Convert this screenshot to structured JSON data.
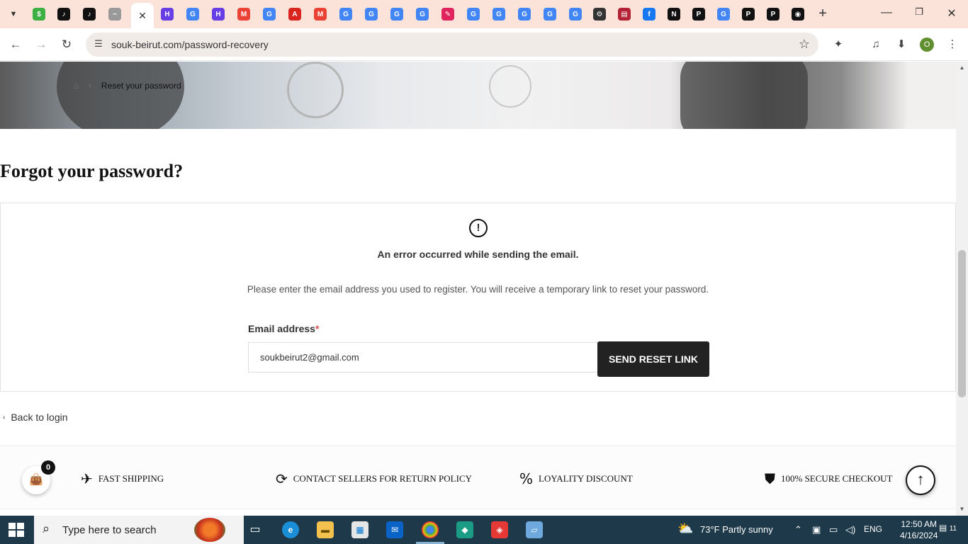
{
  "browser": {
    "tab_favicons": [
      {
        "icon": "dollar-icon",
        "glyph": "$",
        "color": "#3cb043"
      },
      {
        "icon": "tiktok-icon",
        "glyph": "♪",
        "color": "#111111"
      },
      {
        "icon": "tiktok-icon",
        "glyph": "♪",
        "color": "#111111"
      },
      {
        "icon": "souk-logo-icon",
        "glyph": "~",
        "color": "#999999"
      },
      {
        "icon": "hostinger-icon",
        "glyph": "H",
        "color": "#673de6"
      },
      {
        "icon": "google-icon",
        "glyph": "G",
        "color": "#4285f4"
      },
      {
        "icon": "hostinger-icon",
        "glyph": "H",
        "color": "#673de6"
      },
      {
        "icon": "gmail-icon",
        "glyph": "M",
        "color": "#ea4335"
      },
      {
        "icon": "google-icon",
        "glyph": "G",
        "color": "#4285f4"
      },
      {
        "icon": "adobe-icon",
        "glyph": "A",
        "color": "#d9251d"
      },
      {
        "icon": "gmail-icon",
        "glyph": "M",
        "color": "#ea4335"
      },
      {
        "icon": "google-icon",
        "glyph": "G",
        "color": "#4285f4"
      },
      {
        "icon": "google-icon",
        "glyph": "G",
        "color": "#4285f4"
      },
      {
        "icon": "google-icon",
        "glyph": "G",
        "color": "#4285f4"
      },
      {
        "icon": "google-icon",
        "glyph": "G",
        "color": "#4285f4"
      },
      {
        "icon": "feather-icon",
        "glyph": "✎",
        "color": "#e0245e"
      },
      {
        "icon": "google-icon",
        "glyph": "G",
        "color": "#4285f4"
      },
      {
        "icon": "google-icon",
        "glyph": "G",
        "color": "#4285f4"
      },
      {
        "icon": "google-icon",
        "glyph": "G",
        "color": "#4285f4"
      },
      {
        "icon": "google-icon",
        "glyph": "G",
        "color": "#4285f4"
      },
      {
        "icon": "google-icon",
        "glyph": "G",
        "color": "#4285f4"
      },
      {
        "icon": "settings-icon",
        "glyph": "⚙",
        "color": "#333333"
      },
      {
        "icon": "flag-icon",
        "glyph": "▤",
        "color": "#b22234"
      },
      {
        "icon": "facebook-icon",
        "glyph": "f",
        "color": "#1877f2"
      },
      {
        "icon": "notion-icon",
        "glyph": "N",
        "color": "#111111"
      },
      {
        "icon": "picsart-icon",
        "glyph": "P",
        "color": "#111111"
      },
      {
        "icon": "google-icon",
        "glyph": "G",
        "color": "#4285f4"
      },
      {
        "icon": "picsart-icon",
        "glyph": "P",
        "color": "#111111"
      },
      {
        "icon": "picsart-icon",
        "glyph": "P",
        "color": "#111111"
      },
      {
        "icon": "github-icon",
        "glyph": "◉",
        "color": "#111111"
      }
    ],
    "url": "souk-beirut.com/password-recovery"
  },
  "breadcrumb": {
    "current": "Reset your password"
  },
  "page": {
    "title": "Forgot your password?",
    "alert": "An error occurred while sending the email.",
    "instructions": "Please enter the email address you used to register. You will receive a temporary link to reset your password.",
    "email_label": "Email address",
    "required_mark": "*",
    "email_value": "soukbeirut2@gmail.com",
    "submit_label": "SEND RESET LINK",
    "back_link": "Back to login"
  },
  "features": [
    {
      "icon": "plane-icon",
      "glyph": "✈",
      "label": "FAST SHIPPING"
    },
    {
      "icon": "return-icon",
      "glyph": "⟳",
      "label": "CONTACT SELLERS FOR RETURN POLICY"
    },
    {
      "icon": "percent-icon",
      "glyph": "%",
      "label": "LOYALITY DISCOUNT"
    },
    {
      "icon": "shield-icon",
      "glyph": "⛊",
      "label": "100% SECURE CHECKOUT"
    }
  ],
  "cart": {
    "count": "0"
  },
  "taskbar": {
    "search_placeholder": "Type here to search",
    "weather": "73°F  Partly sunny",
    "language": "ENG",
    "time": "12:50 AM",
    "date": "4/16/2024",
    "notifications": "11"
  },
  "colors": {
    "tabstrip": "#fbe3d9",
    "button": "#222222",
    "required": "#d9534f",
    "taskbar": "#1e3a4a"
  }
}
